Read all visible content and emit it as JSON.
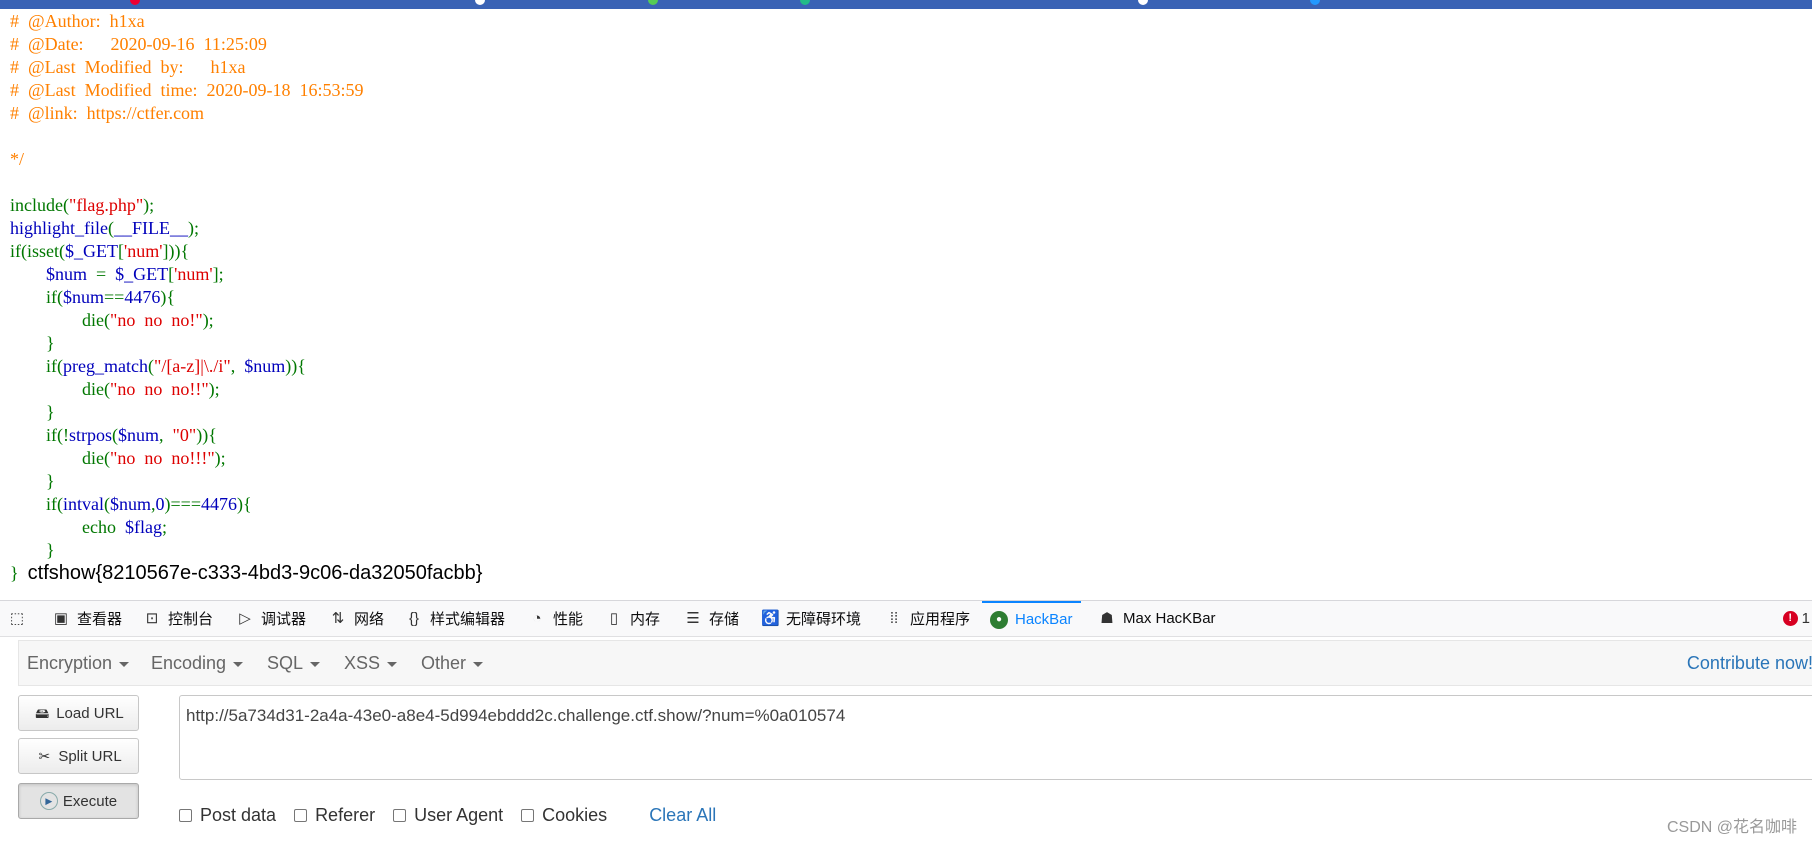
{
  "code": {
    "lines": [
      [
        {
          "c": "cm",
          "t": "#  @Author:  h1xa"
        }
      ],
      [
        {
          "c": "cm",
          "t": "#  @Date:      2020-09-16  11:25:09"
        }
      ],
      [
        {
          "c": "cm",
          "t": "#  @Last  Modified  by:      h1xa"
        }
      ],
      [
        {
          "c": "cm",
          "t": "#  @Last  Modified  time:  2020-09-18  16:53:59"
        }
      ],
      [
        {
          "c": "cm",
          "t": "#  @link:  https://ctfer.com"
        }
      ],
      [],
      [
        {
          "c": "cm",
          "t": "*/"
        }
      ],
      [],
      [
        {
          "c": "kw",
          "t": "include("
        },
        {
          "c": "st",
          "t": "\"flag.php\""
        },
        {
          "c": "kw",
          "t": ");"
        }
      ],
      [
        {
          "c": "df",
          "t": "highlight_file"
        },
        {
          "c": "kw",
          "t": "("
        },
        {
          "c": "df",
          "t": "__FILE__"
        },
        {
          "c": "kw",
          "t": ");"
        }
      ],
      [
        {
          "c": "kw",
          "t": "if(isset("
        },
        {
          "c": "df",
          "t": "$_GET"
        },
        {
          "c": "kw",
          "t": "["
        },
        {
          "c": "st",
          "t": "'num'"
        },
        {
          "c": "kw",
          "t": "])){"
        }
      ],
      [
        {
          "c": "df",
          "t": "        $num  "
        },
        {
          "c": "kw",
          "t": "=  "
        },
        {
          "c": "df",
          "t": "$_GET"
        },
        {
          "c": "kw",
          "t": "["
        },
        {
          "c": "st",
          "t": "'num'"
        },
        {
          "c": "kw",
          "t": "];"
        }
      ],
      [
        {
          "c": "kw",
          "t": "        if("
        },
        {
          "c": "df",
          "t": "$num"
        },
        {
          "c": "kw",
          "t": "=="
        },
        {
          "c": "df",
          "t": "4476"
        },
        {
          "c": "kw",
          "t": "){"
        }
      ],
      [
        {
          "c": "kw",
          "t": "                die("
        },
        {
          "c": "st",
          "t": "\"no  no  no!\""
        },
        {
          "c": "kw",
          "t": ");"
        }
      ],
      [
        {
          "c": "kw",
          "t": "        }"
        }
      ],
      [
        {
          "c": "kw",
          "t": "        if("
        },
        {
          "c": "df",
          "t": "preg_match"
        },
        {
          "c": "kw",
          "t": "("
        },
        {
          "c": "st",
          "t": "\"/[a-z]|\\./i\""
        },
        {
          "c": "kw",
          "t": ",  "
        },
        {
          "c": "df",
          "t": "$num"
        },
        {
          "c": "kw",
          "t": ")){"
        }
      ],
      [
        {
          "c": "kw",
          "t": "                die("
        },
        {
          "c": "st",
          "t": "\"no  no  no!!\""
        },
        {
          "c": "kw",
          "t": ");"
        }
      ],
      [
        {
          "c": "kw",
          "t": "        }"
        }
      ],
      [
        {
          "c": "kw",
          "t": "        if(!"
        },
        {
          "c": "df",
          "t": "strpos"
        },
        {
          "c": "kw",
          "t": "("
        },
        {
          "c": "df",
          "t": "$num"
        },
        {
          "c": "kw",
          "t": ",  "
        },
        {
          "c": "st",
          "t": "\"0\""
        },
        {
          "c": "kw",
          "t": ")){"
        }
      ],
      [
        {
          "c": "kw",
          "t": "                die("
        },
        {
          "c": "st",
          "t": "\"no  no  no!!!\""
        },
        {
          "c": "kw",
          "t": ");"
        }
      ],
      [
        {
          "c": "kw",
          "t": "        }"
        }
      ],
      [
        {
          "c": "kw",
          "t": "        if("
        },
        {
          "c": "df",
          "t": "intval"
        },
        {
          "c": "kw",
          "t": "("
        },
        {
          "c": "df",
          "t": "$num"
        },
        {
          "c": "kw",
          "t": ","
        },
        {
          "c": "df",
          "t": "0"
        },
        {
          "c": "kw",
          "t": ")==="
        },
        {
          "c": "df",
          "t": "4476"
        },
        {
          "c": "kw",
          "t": "){"
        }
      ],
      [
        {
          "c": "kw",
          "t": "                echo  "
        },
        {
          "c": "df",
          "t": "$flag"
        },
        {
          "c": "kw",
          "t": ";"
        }
      ],
      [
        {
          "c": "kw",
          "t": "        }"
        }
      ],
      [
        {
          "c": "kw",
          "t": "}  "
        }
      ]
    ],
    "flag_output": "ctfshow{8210567e-c333-4bd3-9c06-da32050facbb}"
  },
  "devtools": {
    "tabs": [
      {
        "label": "",
        "icon": "picker-icon"
      },
      {
        "label": "查看器",
        "icon": "inspector-icon"
      },
      {
        "label": "控制台",
        "icon": "console-icon"
      },
      {
        "label": "调试器",
        "icon": "debugger-icon"
      },
      {
        "label": "网络",
        "icon": "network-icon"
      },
      {
        "label": "样式编辑器",
        "icon": "style-editor-icon"
      },
      {
        "label": "性能",
        "icon": "performance-icon"
      },
      {
        "label": "内存",
        "icon": "memory-icon"
      },
      {
        "label": "存储",
        "icon": "storage-icon"
      },
      {
        "label": "无障碍环境",
        "icon": "accessibility-icon"
      },
      {
        "label": "应用程序",
        "icon": "application-icon"
      },
      {
        "label": "HackBar",
        "icon": "hackbar-icon"
      },
      {
        "label": "Max HacKBar",
        "icon": "max-hackbar-icon"
      }
    ],
    "active_tab": "HackBar",
    "error_count": "1"
  },
  "hackbar": {
    "menu": [
      "Encryption",
      "Encoding",
      "SQL",
      "XSS",
      "Other"
    ],
    "contribute": "Contribute now!",
    "buttons": {
      "load": "Load URL",
      "split": "Split URL",
      "execute": "Execute"
    },
    "url": "http://5a734d31-2a4a-43e0-a8e4-5d994ebddd2c.challenge.ctf.show/?num=%0a010574",
    "options": [
      "Post data",
      "Referer",
      "User Agent",
      "Cookies"
    ],
    "clear_all": "Clear All"
  },
  "watermark": "CSDN @花名咖啡",
  "colors": {
    "comment": "#ff8000",
    "keyword": "#007700",
    "string": "#dd0000",
    "default": "#0000bb",
    "accent": "#0a84ff",
    "link": "#2a75b8"
  }
}
